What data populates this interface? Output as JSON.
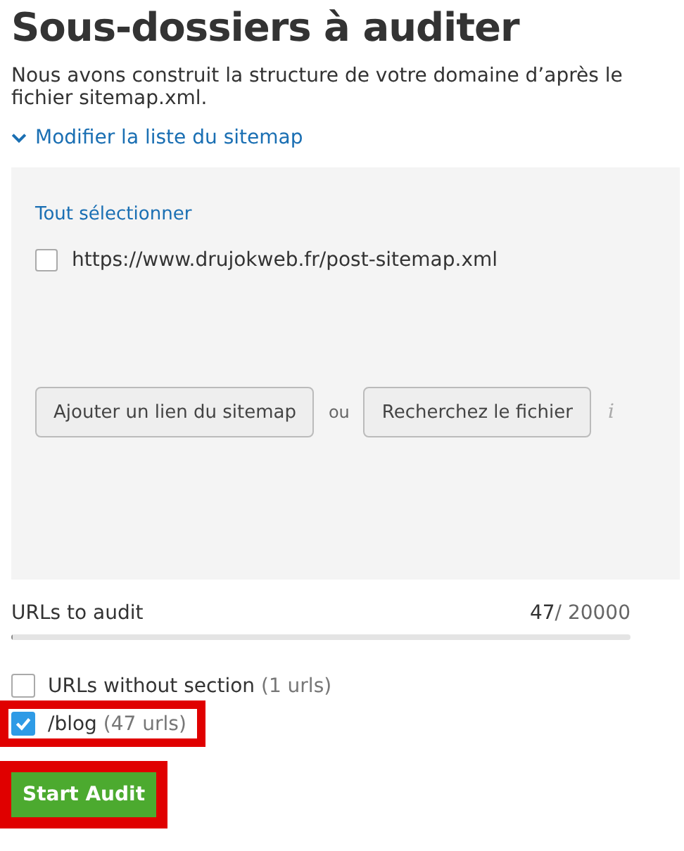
{
  "title": "Sous-dossiers à auditer",
  "description": "Nous avons construit la structure de votre domaine d’après le fichier sitemap.xml.",
  "toggle": {
    "label": "Modifier la liste du sitemap",
    "expanded": true
  },
  "sitemap_panel": {
    "select_all": "Tout sélectionner",
    "sitemaps": [
      {
        "url": "https://www.drujokweb.fr/post-sitemap.xml",
        "checked": false
      }
    ],
    "add_link_button": "Ajouter un lien du sitemap",
    "separator": "ou",
    "browse_button": "Recherchez le fichier",
    "info_icon": "i"
  },
  "urls_to_audit": {
    "label": "URLs to audit",
    "count": "47",
    "limit": "/ 20000",
    "level": 0.0024
  },
  "sections": [
    {
      "name": "URLs without section",
      "count": "(1 urls)",
      "checked": false,
      "highlighted": false
    },
    {
      "name": "/blog",
      "count": "(47 urls)",
      "checked": true,
      "highlighted": true
    }
  ],
  "start_button": {
    "label": "Start Audit",
    "highlighted": true
  }
}
